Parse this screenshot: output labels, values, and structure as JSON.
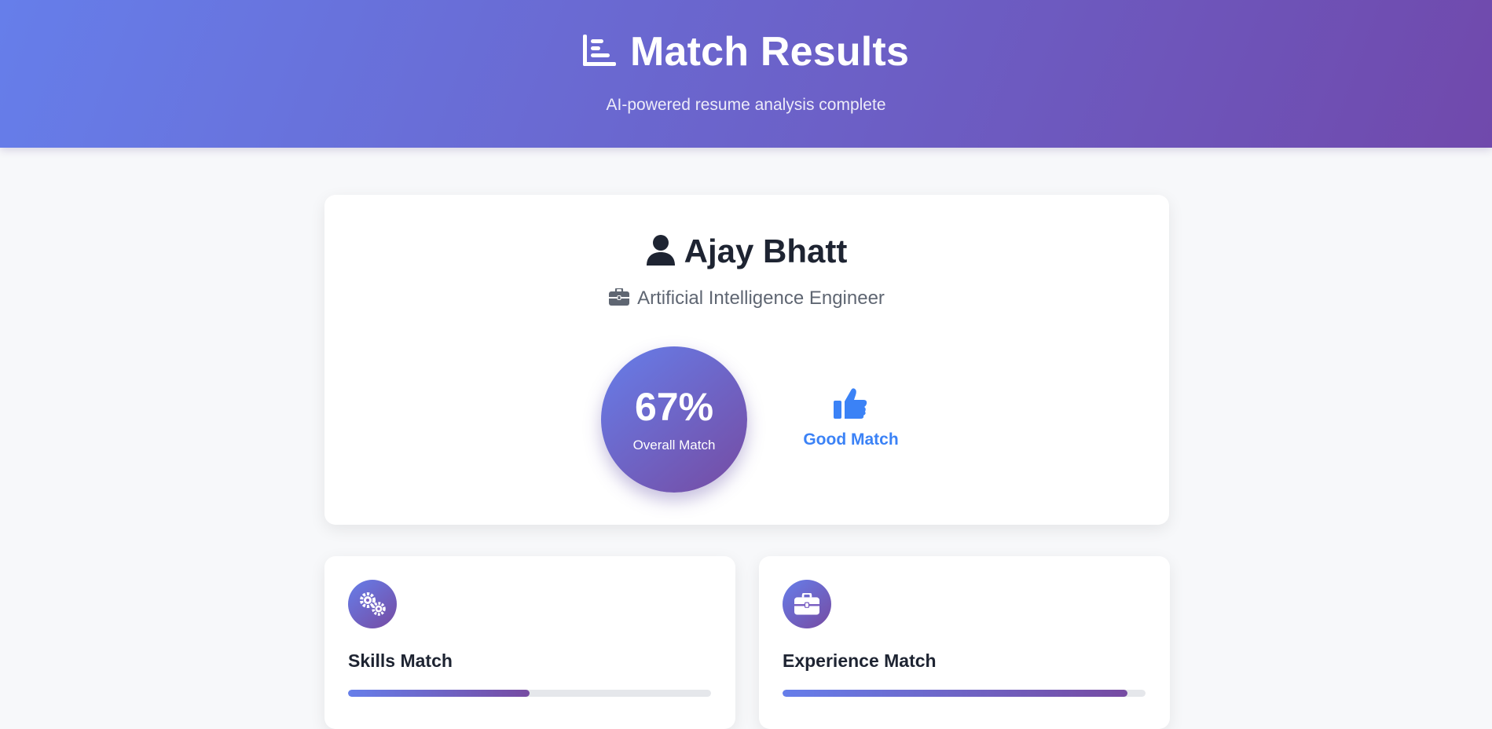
{
  "header": {
    "icon": "chart-bar-icon",
    "title": "Match Results",
    "subtitle": "AI-powered resume analysis complete"
  },
  "candidate": {
    "name": "Ajay Bhatt",
    "name_icon": "user-icon",
    "role": "Artificial Intelligence Engineer",
    "role_icon": "briefcase-icon"
  },
  "score": {
    "value": "67%",
    "label": "Overall Match",
    "verdict": "Good Match",
    "verdict_icon": "thumbs-up-icon",
    "verdict_color": "#3b82f6"
  },
  "metrics": [
    {
      "title": "Skills Match",
      "icon": "gears-icon",
      "fill_fraction": 0.5
    },
    {
      "title": "Experience Match",
      "icon": "briefcase-icon",
      "fill_fraction": 0.95
    }
  ],
  "colors": {
    "gradient_start": "#667eea",
    "gradient_end": "#764ba2",
    "bar_track": "#e5e7eb",
    "page_bg": "#f7f8fa"
  }
}
